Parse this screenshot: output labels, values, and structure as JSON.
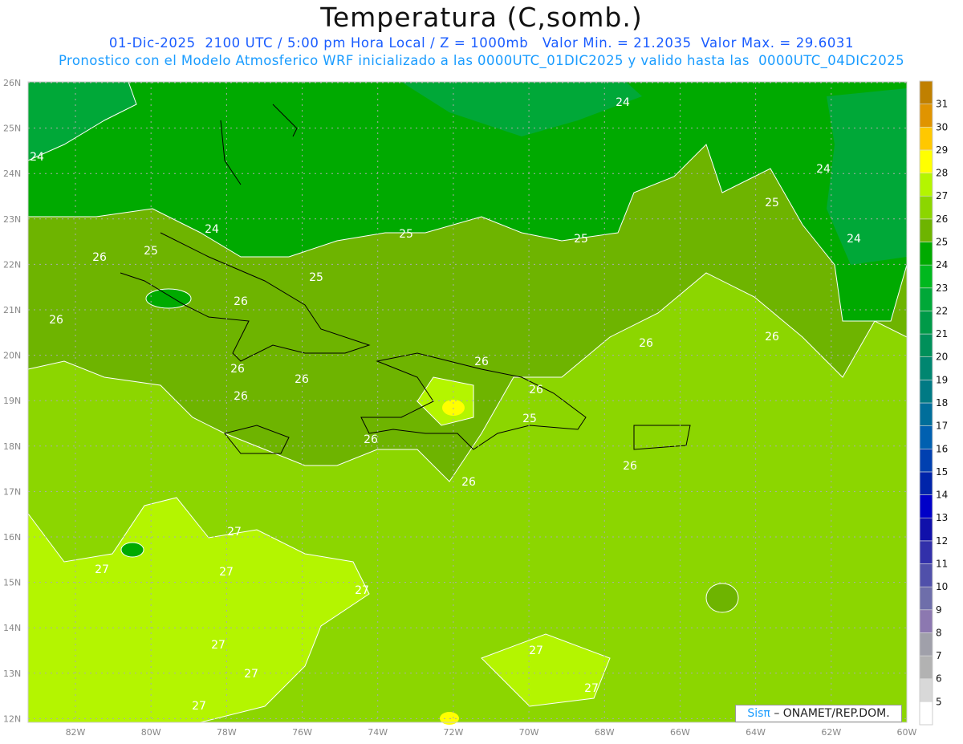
{
  "header": {
    "title": "Temperatura (C,somb.)",
    "line1": "01-Dic-2025  2100 UTC / 5:00 pm Hora Local / Z = 1000mb   Valor Min. = 21.2035  Valor Max. = 29.6031",
    "line2": "Pronostico con el Modelo Atmosferico WRF inicializado a las 0000UTC_01DIC2025 y valido hasta las  0000UTC_04DIC2025"
  },
  "map": {
    "lat_labels": [
      "26N",
      "25N",
      "24N",
      "23N",
      "22N",
      "21N",
      "20N",
      "19N",
      "18N",
      "17N",
      "16N",
      "15N",
      "14N",
      "13N",
      "12N"
    ],
    "lon_labels": [
      "82W",
      "80W",
      "78W",
      "76W",
      "74W",
      "72W",
      "70W",
      "68W",
      "66W",
      "64W",
      "62W",
      "60W"
    ],
    "contour_labels": [
      "24",
      "24",
      "24",
      "24",
      "24",
      "25",
      "25",
      "25",
      "25",
      "25",
      "26",
      "26",
      "26",
      "26",
      "26",
      "26",
      "26",
      "26",
      "26",
      "26",
      "26",
      "26",
      "26",
      "25",
      "27",
      "27",
      "27",
      "27",
      "27",
      "27",
      "27",
      "27",
      "27"
    ]
  },
  "colorbar": {
    "labels": [
      "5",
      "6",
      "7",
      "8",
      "9",
      "10",
      "11",
      "12",
      "13",
      "14",
      "15",
      "16",
      "17",
      "18",
      "19",
      "20",
      "21",
      "22",
      "23",
      "24",
      "25",
      "26",
      "27",
      "28",
      "29",
      "30",
      "31"
    ],
    "colors": [
      "#ffffff",
      "#d8d8d8",
      "#b2b2b2",
      "#a0a0aa",
      "#8c78b0",
      "#6e6eaa",
      "#5050aa",
      "#3230aa",
      "#1010aa",
      "#0000c8",
      "#0024aa",
      "#0040b0",
      "#0060b0",
      "#006e9a",
      "#007a84",
      "#008670",
      "#00905a",
      "#009a48",
      "#00a838",
      "#00b81e",
      "#00aa00",
      "#6eb400",
      "#8cd600",
      "#b4f500",
      "#ffff00",
      "#ffc800",
      "#e09400",
      "#c08000"
    ]
  },
  "credit": {
    "brand": "Sisπ",
    "text": "– ONAMET/REP.DOM."
  },
  "palette": {
    "sea_warm": "#8cd600",
    "band_25": "#6eb400",
    "band_24": "#00aa00",
    "band_23": "#00a838",
    "band_27": "#b4f500",
    "hot": "#ffff00"
  }
}
